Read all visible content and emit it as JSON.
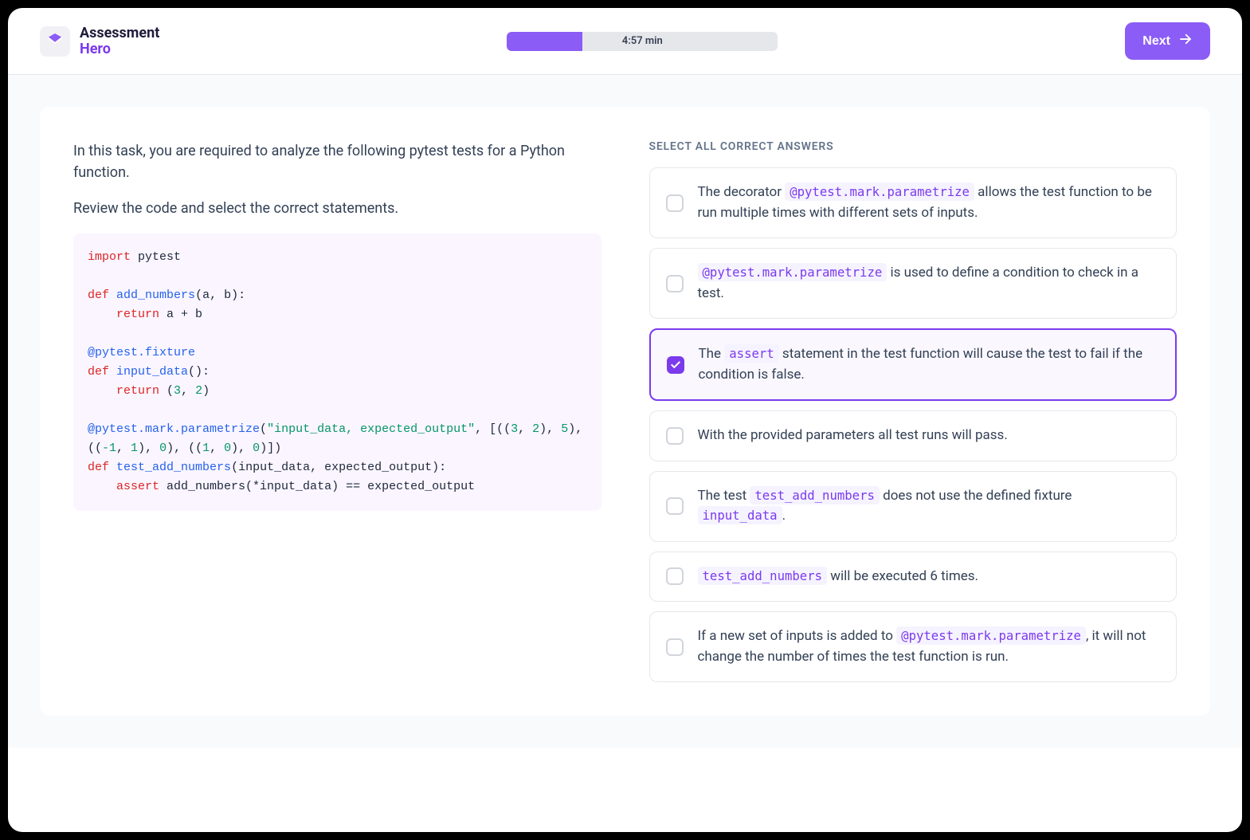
{
  "header": {
    "logo_line1": "Assessment",
    "logo_line2": "Hero",
    "progress_percent": 28,
    "timer_label": "4:57 min",
    "next_label": "Next"
  },
  "task": {
    "p1": "In this task, you are required to analyze the following pytest tests for a Python function.",
    "p2": "Review the code and select the correct statements."
  },
  "code": {
    "tokens": [
      {
        "t": "import",
        "c": "kw"
      },
      {
        "t": " pytest\n\n"
      },
      {
        "t": "def",
        "c": "kw"
      },
      {
        "t": " "
      },
      {
        "t": "add_numbers",
        "c": "fn"
      },
      {
        "t": "(a, b):\n    "
      },
      {
        "t": "return",
        "c": "kw"
      },
      {
        "t": " a + b\n\n"
      },
      {
        "t": "@pytest.fixture",
        "c": "dec"
      },
      {
        "t": "\n"
      },
      {
        "t": "def",
        "c": "kw"
      },
      {
        "t": " "
      },
      {
        "t": "input_data",
        "c": "fn"
      },
      {
        "t": "():\n    "
      },
      {
        "t": "return",
        "c": "kw"
      },
      {
        "t": " ("
      },
      {
        "t": "3",
        "c": "num"
      },
      {
        "t": ", "
      },
      {
        "t": "2",
        "c": "num"
      },
      {
        "t": ")\n\n"
      },
      {
        "t": "@pytest.mark.parametrize",
        "c": "dec"
      },
      {
        "t": "("
      },
      {
        "t": "\"input_data, expected_output\"",
        "c": "str"
      },
      {
        "t": ", [(("
      },
      {
        "t": "3",
        "c": "num"
      },
      {
        "t": ", "
      },
      {
        "t": "2",
        "c": "num"
      },
      {
        "t": "), "
      },
      {
        "t": "5",
        "c": "num"
      },
      {
        "t": "), (("
      },
      {
        "t": "-1",
        "c": "num"
      },
      {
        "t": ", "
      },
      {
        "t": "1",
        "c": "num"
      },
      {
        "t": "), "
      },
      {
        "t": "0",
        "c": "num"
      },
      {
        "t": "), (("
      },
      {
        "t": "1",
        "c": "num"
      },
      {
        "t": ", "
      },
      {
        "t": "0",
        "c": "num"
      },
      {
        "t": "), "
      },
      {
        "t": "0",
        "c": "num"
      },
      {
        "t": ")])\n"
      },
      {
        "t": "def",
        "c": "kw"
      },
      {
        "t": " "
      },
      {
        "t": "test_add_numbers",
        "c": "fn"
      },
      {
        "t": "(input_data, expected_output):\n    "
      },
      {
        "t": "assert",
        "c": "kw"
      },
      {
        "t": " add_numbers(*input_data) == expected_output"
      }
    ]
  },
  "answers": {
    "header": "SELECT ALL CORRECT ANSWERS",
    "items": [
      {
        "selected": false,
        "parts": [
          {
            "t": "The decorator "
          },
          {
            "t": "@pytest.mark.parametrize",
            "code": true
          },
          {
            "t": " allows the test function to be run multiple times with different sets of inputs."
          }
        ]
      },
      {
        "selected": false,
        "parts": [
          {
            "t": "@pytest.mark.parametrize",
            "code": true
          },
          {
            "t": " is used to define a condition to check in a test."
          }
        ]
      },
      {
        "selected": true,
        "parts": [
          {
            "t": "The "
          },
          {
            "t": "assert",
            "code": true
          },
          {
            "t": " statement in the test function will cause the test to fail if the condition is false."
          }
        ]
      },
      {
        "selected": false,
        "parts": [
          {
            "t": "With the provided parameters all test runs will pass."
          }
        ]
      },
      {
        "selected": false,
        "parts": [
          {
            "t": "The test "
          },
          {
            "t": "test_add_numbers",
            "code": true
          },
          {
            "t": " does not use the defined fixture "
          },
          {
            "t": "input_data",
            "code": true
          },
          {
            "t": "."
          }
        ]
      },
      {
        "selected": false,
        "parts": [
          {
            "t": "test_add_numbers",
            "code": true
          },
          {
            "t": " will be executed 6 times."
          }
        ]
      },
      {
        "selected": false,
        "parts": [
          {
            "t": "If a new set of inputs is added to "
          },
          {
            "t": "@pytest.mark.parametrize",
            "code": true
          },
          {
            "t": ", it will not change the number of times the test function is run."
          }
        ]
      }
    ]
  }
}
